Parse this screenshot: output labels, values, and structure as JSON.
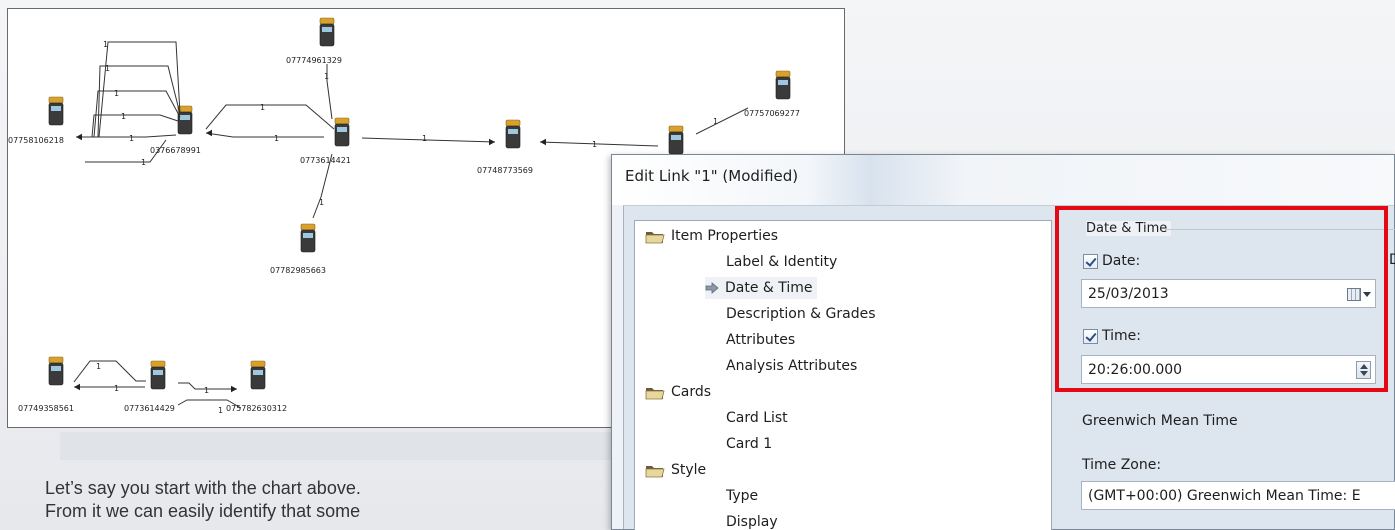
{
  "chart": {
    "nodes": [
      {
        "id": "07774961329",
        "label": "07774961329"
      },
      {
        "id": "07757069277",
        "label": "07757069277"
      },
      {
        "id": "07758106218",
        "label": "07758106218"
      },
      {
        "id": "0376678991",
        "label": "0376678991"
      },
      {
        "id": "0773614421",
        "label": "0773614421"
      },
      {
        "id": "07748773569",
        "label": "07748773569"
      },
      {
        "id": "07782985663",
        "label": "07782985663"
      },
      {
        "id": "07749358561",
        "label": "07749358561"
      },
      {
        "id": "0773614429",
        "label": "0773614429"
      },
      {
        "id": "075782630312",
        "label": "075782630312"
      }
    ],
    "link_label": "1",
    "icon": "mobile-phone-icon"
  },
  "caption": {
    "line1": "Let’s say you start with the chart above.",
    "line2": "From it we can easily identify that some"
  },
  "dialog": {
    "title": "Edit Link \"1\" (Modified)",
    "tree": [
      {
        "label": "Item Properties",
        "type": "folder"
      },
      {
        "label": "Label & Identity",
        "type": "item"
      },
      {
        "label": "Date & Time",
        "type": "item",
        "selected": true
      },
      {
        "label": "Description & Grades",
        "type": "item"
      },
      {
        "label": "Attributes",
        "type": "item"
      },
      {
        "label": "Analysis Attributes",
        "type": "item"
      },
      {
        "label": "Cards",
        "type": "folder"
      },
      {
        "label": "Card List",
        "type": "item"
      },
      {
        "label": "Card 1",
        "type": "item"
      },
      {
        "label": "Style",
        "type": "folder"
      },
      {
        "label": "Type",
        "type": "item"
      },
      {
        "label": "Display",
        "type": "item"
      }
    ],
    "group_title": "Date & Time",
    "date_check_label": "Date:",
    "date_checked": true,
    "date_value": "25/03/2013",
    "time_check_label": "Time:",
    "time_checked": true,
    "time_value": "20:26:00.000",
    "timezone_name": "Greenwich Mean Time",
    "timezone_label": "Time Zone:",
    "timezone_value": "(GMT+00:00) Greenwich Mean Time: E",
    "side_letter": "D",
    "highlight_color": "#e50914"
  }
}
